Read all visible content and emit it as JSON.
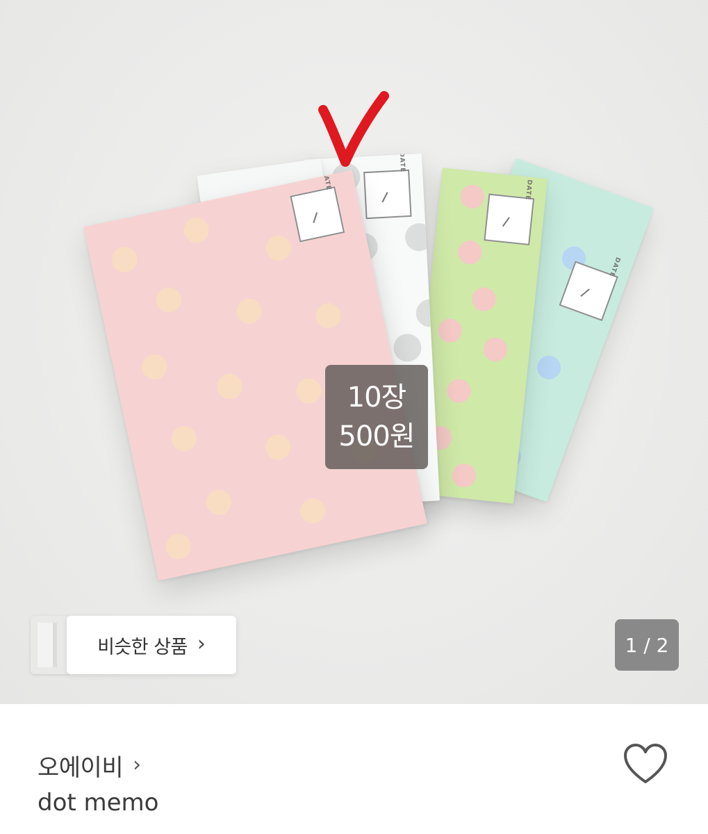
{
  "hero": {
    "price_line1": "10장",
    "price_line2": "500원",
    "memo_stamp": "DATE",
    "similar_label": "비슷한 상품",
    "similar_chevron": "›",
    "page_indicator": "1 / 2"
  },
  "product": {
    "shop_name": "오에이비",
    "shop_chevron": "›",
    "title": "dot memo"
  },
  "icons": {
    "checkmark": "checkmark-icon",
    "heart": "heart-icon",
    "chevron": "chevron-right-icon"
  },
  "colors": {
    "pink_memo": "#f6d3d2",
    "white_memo": "#f8f9f9",
    "green_memo": "#cfe9a8",
    "mint_memo": "#c7ecdf",
    "checkmark": "#e0181f",
    "badge": "#5f5a58",
    "text": "#3a3a3a"
  }
}
